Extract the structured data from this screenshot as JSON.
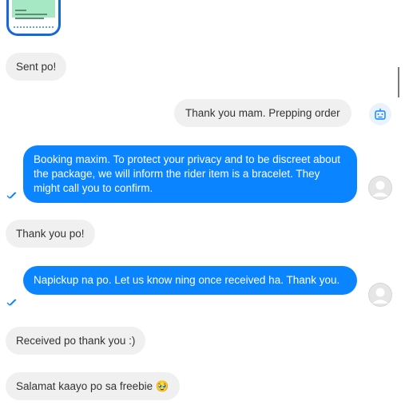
{
  "messages": [
    {
      "text": "Sent po!"
    },
    {
      "text": "Thank you mam. Prepping order"
    },
    {
      "text": "Booking maxim. To protect your privacy and to be discreet about the package, we will inform the rider item is a bracelet. They might call you to confirm."
    },
    {
      "text": "Thank you po!"
    },
    {
      "text": "Napickup na po. Let us know ning once received ha. Thank you."
    },
    {
      "text": "Received po thank you :)"
    },
    {
      "text": "Salamat kaayo po sa freebie 🥹"
    }
  ],
  "colors": {
    "accent": "#0a84ff",
    "incoming_bg": "#f0f0f0"
  },
  "icons": [
    "image-thumbnail",
    "bot-icon",
    "avatar-icon",
    "seen-check-icon"
  ]
}
